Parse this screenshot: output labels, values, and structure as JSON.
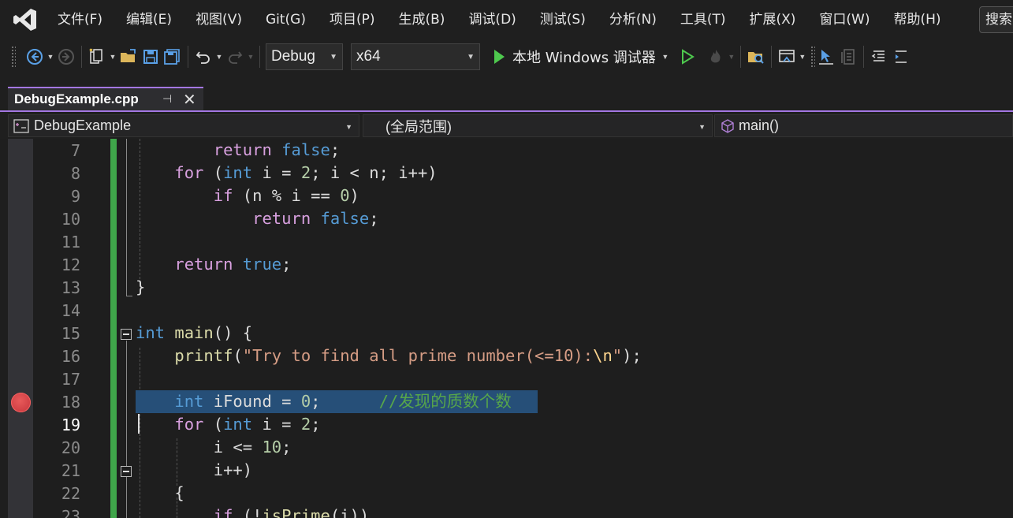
{
  "menu": {
    "items": [
      "文件(F)",
      "编辑(E)",
      "视图(V)",
      "Git(G)",
      "项目(P)",
      "生成(B)",
      "调试(D)",
      "测试(S)",
      "分析(N)",
      "工具(T)",
      "扩展(X)",
      "窗口(W)",
      "帮助(H)"
    ],
    "search_label": "搜索"
  },
  "toolbar": {
    "config": "Debug",
    "platform": "x64",
    "run_label": "本地 Windows 调试器"
  },
  "tab": {
    "title": "DebugExample.cpp"
  },
  "nav": {
    "project": "DebugExample",
    "scope": "(全局范围)",
    "member": "main()"
  },
  "editor": {
    "line_numbers": [
      "7",
      "8",
      "9",
      "10",
      "11",
      "12",
      "13",
      "14",
      "15",
      "16",
      "17",
      "18",
      "19",
      "20",
      "21",
      "22",
      "23"
    ],
    "current_line": "19",
    "breakpoint_line": "18"
  },
  "colors": {
    "accent": "#a377e2",
    "keyword": "#569cd6",
    "control": "#d8a0df",
    "string": "#d69d85",
    "comment": "#57a64a",
    "selection": "#264f78",
    "breakpoint": "#c5343b",
    "change_bar": "#3fa64a"
  }
}
